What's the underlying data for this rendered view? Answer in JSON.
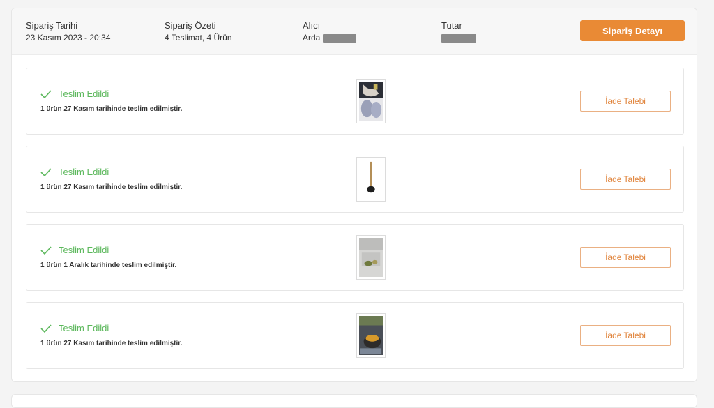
{
  "order": {
    "date_label": "Sipariş Tarihi",
    "date_value": "23 Kasım 2023 - 20:34",
    "summary_label": "Sipariş Özeti",
    "summary_value": "4 Teslimat, 4 Ürün",
    "recipient_label": "Alıcı",
    "recipient_name": "Arda",
    "total_label": "Tutar",
    "detail_button": "Sipariş Detayı"
  },
  "deliveries": [
    {
      "status": "Teslim Edildi",
      "message": "1 ürün 27 Kasım tarihinde teslim edilmiştir.",
      "return_label": "İade Talebi"
    },
    {
      "status": "Teslim Edildi",
      "message": "1 ürün 27 Kasım tarihinde teslim edilmiştir.",
      "return_label": "İade Talebi"
    },
    {
      "status": "Teslim Edildi",
      "message": "1 ürün 1 Aralık tarihinde teslim edilmiştir.",
      "return_label": "İade Talebi"
    },
    {
      "status": "Teslim Edildi",
      "message": "1 ürün 27 Kasım tarihinde teslim edilmiştir.",
      "return_label": "İade Talebi"
    }
  ],
  "colors": {
    "accent": "#e98a35",
    "success": "#5cb85c",
    "outline_button": "#eab083"
  },
  "icons": {
    "status": "check-icon"
  }
}
